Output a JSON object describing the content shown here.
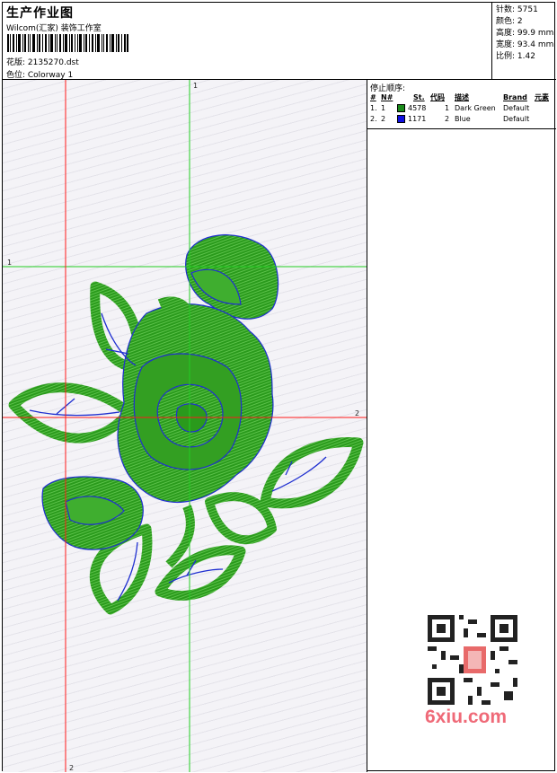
{
  "header": {
    "title": "生产作业图",
    "studio": "Wilcom(汇家) 装饰工作室",
    "design_line": "花版: 2135270.dst",
    "colorway_line": "色位: Colorway 1"
  },
  "stats": [
    {
      "label": "针数:",
      "value": "5751"
    },
    {
      "label": "颜色:",
      "value": "2"
    },
    {
      "label": "高度:",
      "value": "99.9 mm"
    },
    {
      "label": "宽度:",
      "value": "93.4 mm"
    },
    {
      "label": "比例:",
      "value": "1.42"
    }
  ],
  "stop_sequence": {
    "title": "停止顺序:",
    "columns": [
      "#",
      "N#",
      "St.",
      "代码",
      "描述",
      "Brand",
      "元素"
    ],
    "rows": [
      {
        "seq": "1.",
        "n": "1",
        "color": "#1a8a1a",
        "stitches": "4578",
        "code": "1",
        "desc": "Dark Green",
        "brand": "Default"
      },
      {
        "seq": "2.",
        "n": "2",
        "color": "#1010e0",
        "stitches": "1171",
        "code": "2",
        "desc": "Blue",
        "brand": "Default"
      }
    ]
  },
  "guides": {
    "green_vertical": "1",
    "green_horizontal": "1",
    "red_vertical": "2",
    "red_horizontal": "2"
  },
  "colors": {
    "green_thread": "#2a9a1c",
    "blue_thread": "#1f2fd0",
    "guide_green": "#22cc22",
    "guide_red": "#ff1a1a"
  },
  "watermark": "6xiu.com"
}
